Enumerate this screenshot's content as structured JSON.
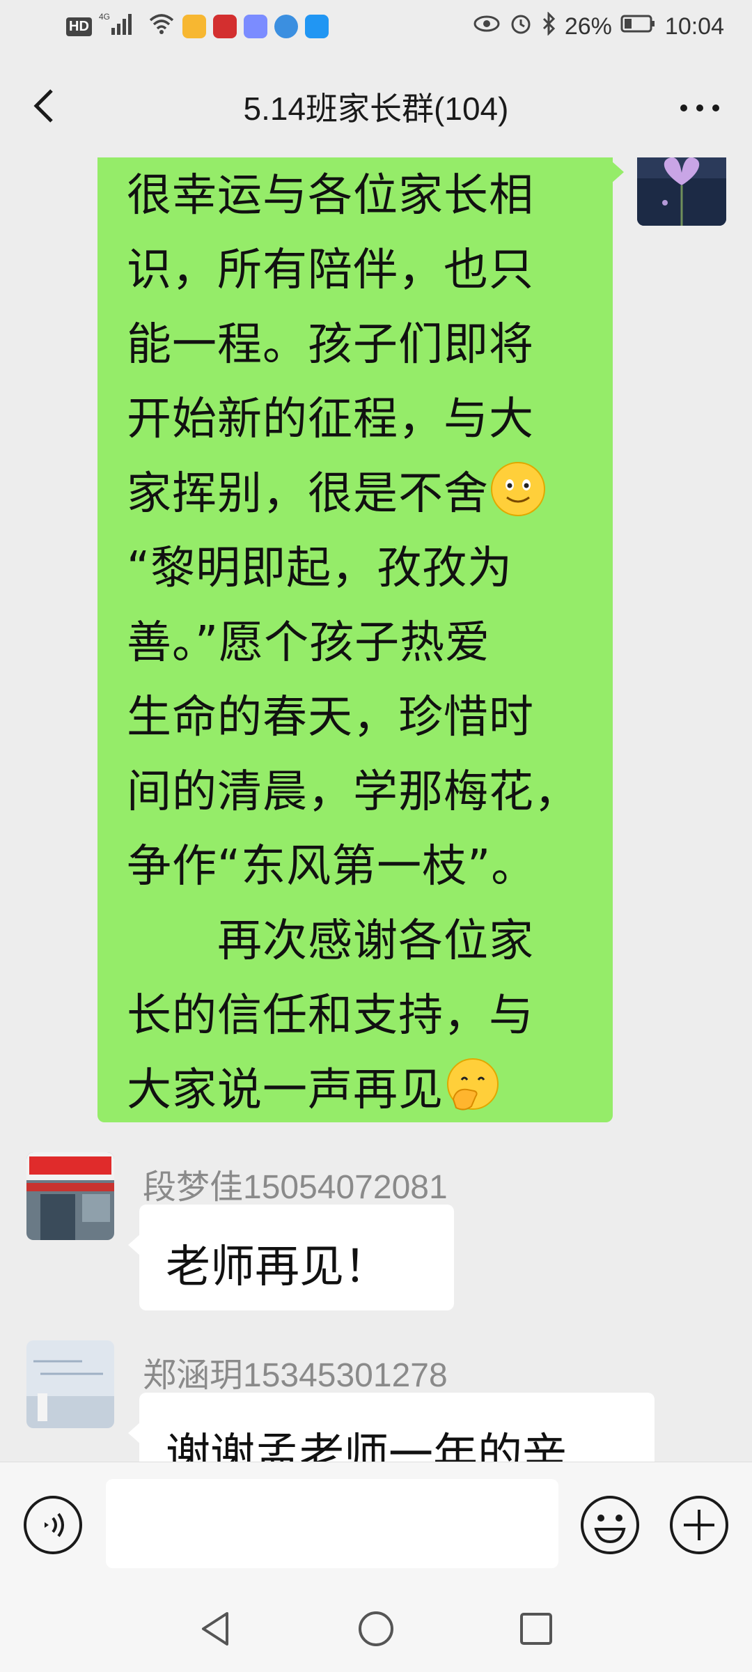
{
  "status_bar": {
    "network_badge": "HD",
    "network_type": "4G",
    "battery": "26%",
    "time": "10:04"
  },
  "header": {
    "title": "5.14班家长群(104)"
  },
  "messages": {
    "outgoing": {
      "lines": [
        "很幸运与各位家长相",
        "识，所有陪伴，也只",
        "能一程。孩子们即将",
        "开始新的征程，与大",
        "家挥别，很是不舍",
        "“黎明即起，孜孜为",
        "善。”愿个孩子热爱",
        "生命的春天，珍惜时",
        "间的清晨，学那梅花，",
        "争作“东风第一枝”。",
        "　　再次感谢各位家",
        "长的信任和支持，与",
        "大家说一声再见"
      ]
    },
    "incoming": [
      {
        "sender": "段梦佳15054072081",
        "text": "老师再见！"
      },
      {
        "sender": "郑涵玥15345301278",
        "text": "谢谢孟老师一年的辛"
      }
    ]
  },
  "input_bar": {
    "placeholder": ""
  },
  "colors": {
    "outgoing_bubble": "#95ec69",
    "incoming_bubble": "#ffffff",
    "background": "#ededed"
  },
  "icons": {
    "voice": "voice-icon",
    "emoji": "emoji-icon",
    "plus": "plus-icon",
    "back": "chevron-left-icon",
    "more": "more-dots-icon"
  }
}
